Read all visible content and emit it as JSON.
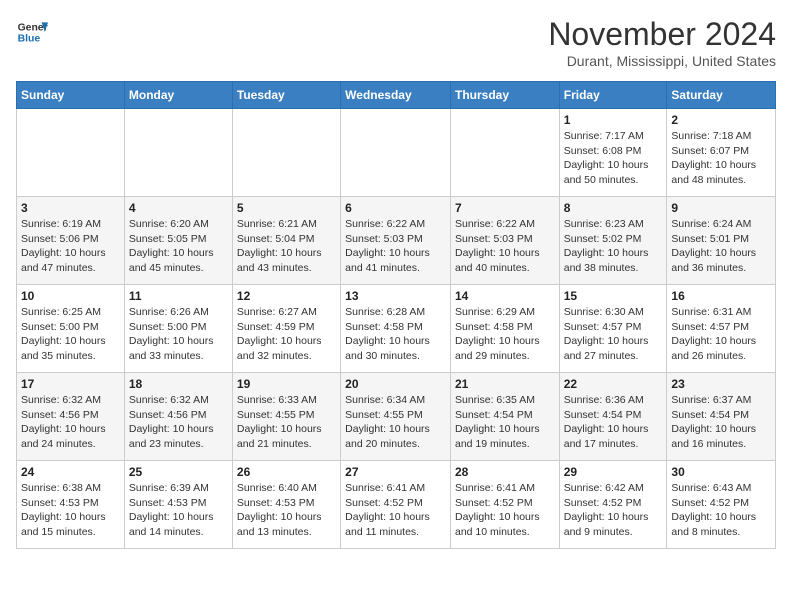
{
  "header": {
    "logo_line1": "General",
    "logo_line2": "Blue",
    "month": "November 2024",
    "location": "Durant, Mississippi, United States"
  },
  "weekdays": [
    "Sunday",
    "Monday",
    "Tuesday",
    "Wednesday",
    "Thursday",
    "Friday",
    "Saturday"
  ],
  "weeks": [
    [
      {
        "day": "",
        "info": ""
      },
      {
        "day": "",
        "info": ""
      },
      {
        "day": "",
        "info": ""
      },
      {
        "day": "",
        "info": ""
      },
      {
        "day": "",
        "info": ""
      },
      {
        "day": "1",
        "info": "Sunrise: 7:17 AM\nSunset: 6:08 PM\nDaylight: 10 hours and 50 minutes."
      },
      {
        "day": "2",
        "info": "Sunrise: 7:18 AM\nSunset: 6:07 PM\nDaylight: 10 hours and 48 minutes."
      }
    ],
    [
      {
        "day": "3",
        "info": "Sunrise: 6:19 AM\nSunset: 5:06 PM\nDaylight: 10 hours and 47 minutes."
      },
      {
        "day": "4",
        "info": "Sunrise: 6:20 AM\nSunset: 5:05 PM\nDaylight: 10 hours and 45 minutes."
      },
      {
        "day": "5",
        "info": "Sunrise: 6:21 AM\nSunset: 5:04 PM\nDaylight: 10 hours and 43 minutes."
      },
      {
        "day": "6",
        "info": "Sunrise: 6:22 AM\nSunset: 5:03 PM\nDaylight: 10 hours and 41 minutes."
      },
      {
        "day": "7",
        "info": "Sunrise: 6:22 AM\nSunset: 5:03 PM\nDaylight: 10 hours and 40 minutes."
      },
      {
        "day": "8",
        "info": "Sunrise: 6:23 AM\nSunset: 5:02 PM\nDaylight: 10 hours and 38 minutes."
      },
      {
        "day": "9",
        "info": "Sunrise: 6:24 AM\nSunset: 5:01 PM\nDaylight: 10 hours and 36 minutes."
      }
    ],
    [
      {
        "day": "10",
        "info": "Sunrise: 6:25 AM\nSunset: 5:00 PM\nDaylight: 10 hours and 35 minutes."
      },
      {
        "day": "11",
        "info": "Sunrise: 6:26 AM\nSunset: 5:00 PM\nDaylight: 10 hours and 33 minutes."
      },
      {
        "day": "12",
        "info": "Sunrise: 6:27 AM\nSunset: 4:59 PM\nDaylight: 10 hours and 32 minutes."
      },
      {
        "day": "13",
        "info": "Sunrise: 6:28 AM\nSunset: 4:58 PM\nDaylight: 10 hours and 30 minutes."
      },
      {
        "day": "14",
        "info": "Sunrise: 6:29 AM\nSunset: 4:58 PM\nDaylight: 10 hours and 29 minutes."
      },
      {
        "day": "15",
        "info": "Sunrise: 6:30 AM\nSunset: 4:57 PM\nDaylight: 10 hours and 27 minutes."
      },
      {
        "day": "16",
        "info": "Sunrise: 6:31 AM\nSunset: 4:57 PM\nDaylight: 10 hours and 26 minutes."
      }
    ],
    [
      {
        "day": "17",
        "info": "Sunrise: 6:32 AM\nSunset: 4:56 PM\nDaylight: 10 hours and 24 minutes."
      },
      {
        "day": "18",
        "info": "Sunrise: 6:32 AM\nSunset: 4:56 PM\nDaylight: 10 hours and 23 minutes."
      },
      {
        "day": "19",
        "info": "Sunrise: 6:33 AM\nSunset: 4:55 PM\nDaylight: 10 hours and 21 minutes."
      },
      {
        "day": "20",
        "info": "Sunrise: 6:34 AM\nSunset: 4:55 PM\nDaylight: 10 hours and 20 minutes."
      },
      {
        "day": "21",
        "info": "Sunrise: 6:35 AM\nSunset: 4:54 PM\nDaylight: 10 hours and 19 minutes."
      },
      {
        "day": "22",
        "info": "Sunrise: 6:36 AM\nSunset: 4:54 PM\nDaylight: 10 hours and 17 minutes."
      },
      {
        "day": "23",
        "info": "Sunrise: 6:37 AM\nSunset: 4:54 PM\nDaylight: 10 hours and 16 minutes."
      }
    ],
    [
      {
        "day": "24",
        "info": "Sunrise: 6:38 AM\nSunset: 4:53 PM\nDaylight: 10 hours and 15 minutes."
      },
      {
        "day": "25",
        "info": "Sunrise: 6:39 AM\nSunset: 4:53 PM\nDaylight: 10 hours and 14 minutes."
      },
      {
        "day": "26",
        "info": "Sunrise: 6:40 AM\nSunset: 4:53 PM\nDaylight: 10 hours and 13 minutes."
      },
      {
        "day": "27",
        "info": "Sunrise: 6:41 AM\nSunset: 4:52 PM\nDaylight: 10 hours and 11 minutes."
      },
      {
        "day": "28",
        "info": "Sunrise: 6:41 AM\nSunset: 4:52 PM\nDaylight: 10 hours and 10 minutes."
      },
      {
        "day": "29",
        "info": "Sunrise: 6:42 AM\nSunset: 4:52 PM\nDaylight: 10 hours and 9 minutes."
      },
      {
        "day": "30",
        "info": "Sunrise: 6:43 AM\nSunset: 4:52 PM\nDaylight: 10 hours and 8 minutes."
      }
    ]
  ]
}
